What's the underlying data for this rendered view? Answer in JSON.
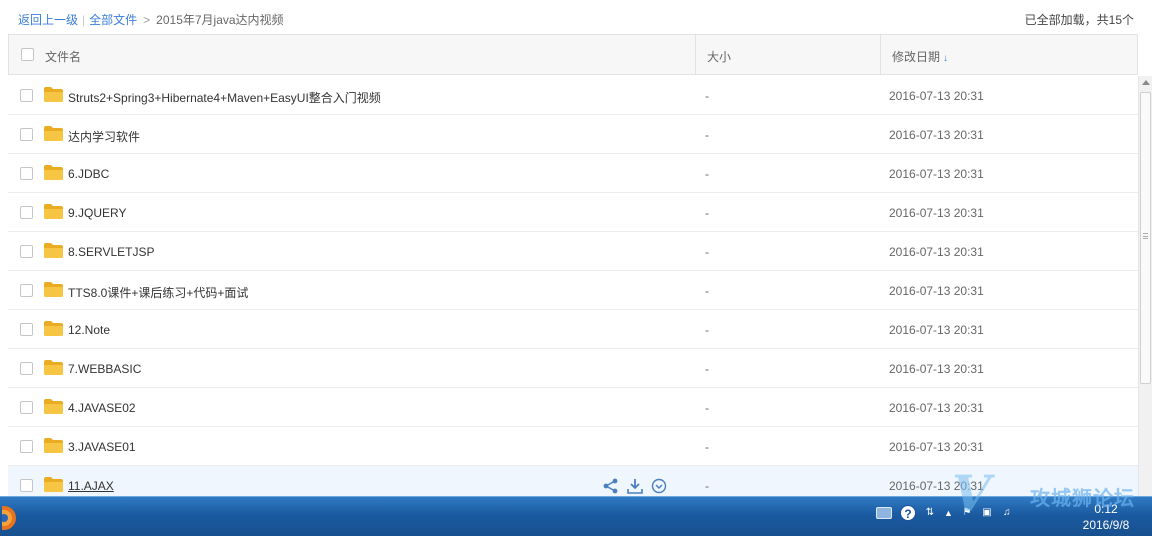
{
  "breadcrumb": {
    "back": "返回上一级",
    "separator": "|",
    "all_files": "全部文件",
    "arrow": ">",
    "current": "2015年7月java达内视频"
  },
  "load_status": "已全部加载，共15个",
  "table": {
    "col_name": "文件名",
    "col_size": "大小",
    "col_date": "修改日期",
    "sort_icon": "arrow-down-icon"
  },
  "rows": [
    {
      "name": "Struts2+Spring3+Hibernate4+Maven+EasyUI整合入门视频",
      "size": "-",
      "date": "2016-07-13 20:31"
    },
    {
      "name": "达内学习软件",
      "size": "-",
      "date": "2016-07-13 20:31"
    },
    {
      "name": "6.JDBC",
      "size": "-",
      "date": "2016-07-13 20:31"
    },
    {
      "name": "9.JQUERY",
      "size": "-",
      "date": "2016-07-13 20:31"
    },
    {
      "name": "8.SERVLETJSP",
      "size": "-",
      "date": "2016-07-13 20:31"
    },
    {
      "name": "TTS8.0课件+课后练习+代码+面试",
      "size": "-",
      "date": "2016-07-13 20:31"
    },
    {
      "name": "12.Note",
      "size": "-",
      "date": "2016-07-13 20:31"
    },
    {
      "name": "7.WEBBASIC",
      "size": "-",
      "date": "2016-07-13 20:31"
    },
    {
      "name": "4.JAVASE02",
      "size": "-",
      "date": "2016-07-13 20:31"
    },
    {
      "name": "3.JAVASE01",
      "size": "-",
      "date": "2016-07-13 20:31"
    },
    {
      "name": "11.AJAX",
      "size": "-",
      "date": "2016-07-13 20:31"
    }
  ],
  "hovered_row_index": 10,
  "row_actions": [
    "share-icon",
    "download-icon",
    "more-icon"
  ],
  "taskbar": {
    "time": "0:12",
    "date": "2016/9/8",
    "help_label": "?"
  },
  "watermark": {
    "logo": "V",
    "text": "攻城狮论坛"
  },
  "colors": {
    "link": "#3b7dd8",
    "folder": "#f6c544",
    "taskbar": "#1b5aa0",
    "hover_row": "#f0f6fd"
  }
}
